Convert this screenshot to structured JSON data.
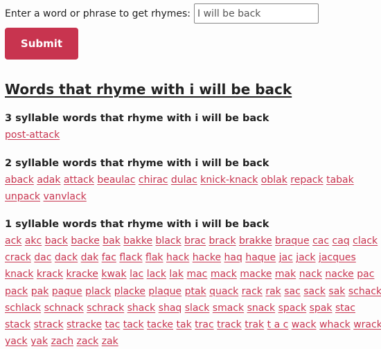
{
  "form": {
    "label": "Enter a word or phrase to get rhymes:",
    "input_value": "I will be back",
    "submit_label": "Submit"
  },
  "colors": {
    "accent": "#c8344f",
    "text": "#222222"
  },
  "results": {
    "title": "Words that rhyme with i will be back",
    "sections": [
      {
        "heading": "3 syllable words that rhyme with i will be back",
        "words": [
          "post-attack"
        ]
      },
      {
        "heading": "2 syllable words that rhyme with i will be back",
        "words": [
          "aback",
          "adak",
          "attack",
          "beaulac",
          "chirac",
          "dulac",
          "knick-knack",
          "oblak",
          "repack",
          "tabak",
          "unpack",
          "vanvlack"
        ]
      },
      {
        "heading": "1 syllable words that rhyme with i will be back",
        "words": [
          "ack",
          "akc",
          "back",
          "backe",
          "bak",
          "bakke",
          "black",
          "brac",
          "brack",
          "brakke",
          "braque",
          "cac",
          "caq",
          "clack",
          "crack",
          "dac",
          "dack",
          "dak",
          "fac",
          "flack",
          "flak",
          "hack",
          "hacke",
          "haq",
          "haque",
          "jac",
          "jack",
          "jacques",
          "knack",
          "krack",
          "kracke",
          "kwak",
          "lac",
          "lack",
          "lak",
          "mac",
          "mack",
          "macke",
          "mak",
          "nack",
          "nacke",
          "pac",
          "pack",
          "pak",
          "paque",
          "plack",
          "placke",
          "plaque",
          "ptak",
          "quack",
          "rack",
          "rak",
          "sac",
          "sack",
          "sak",
          "schack",
          "schlack",
          "schnack",
          "schrack",
          "shack",
          "shaq",
          "slack",
          "smack",
          "snack",
          "spack",
          "spak",
          "stac",
          "stack",
          "strack",
          "stracke",
          "tac",
          "tack",
          "tacke",
          "tak",
          "trac",
          "track",
          "trak",
          "t a c",
          "wack",
          "whack",
          "wrack",
          "yack",
          "yak",
          "zach",
          "zack",
          "zak"
        ]
      }
    ]
  }
}
